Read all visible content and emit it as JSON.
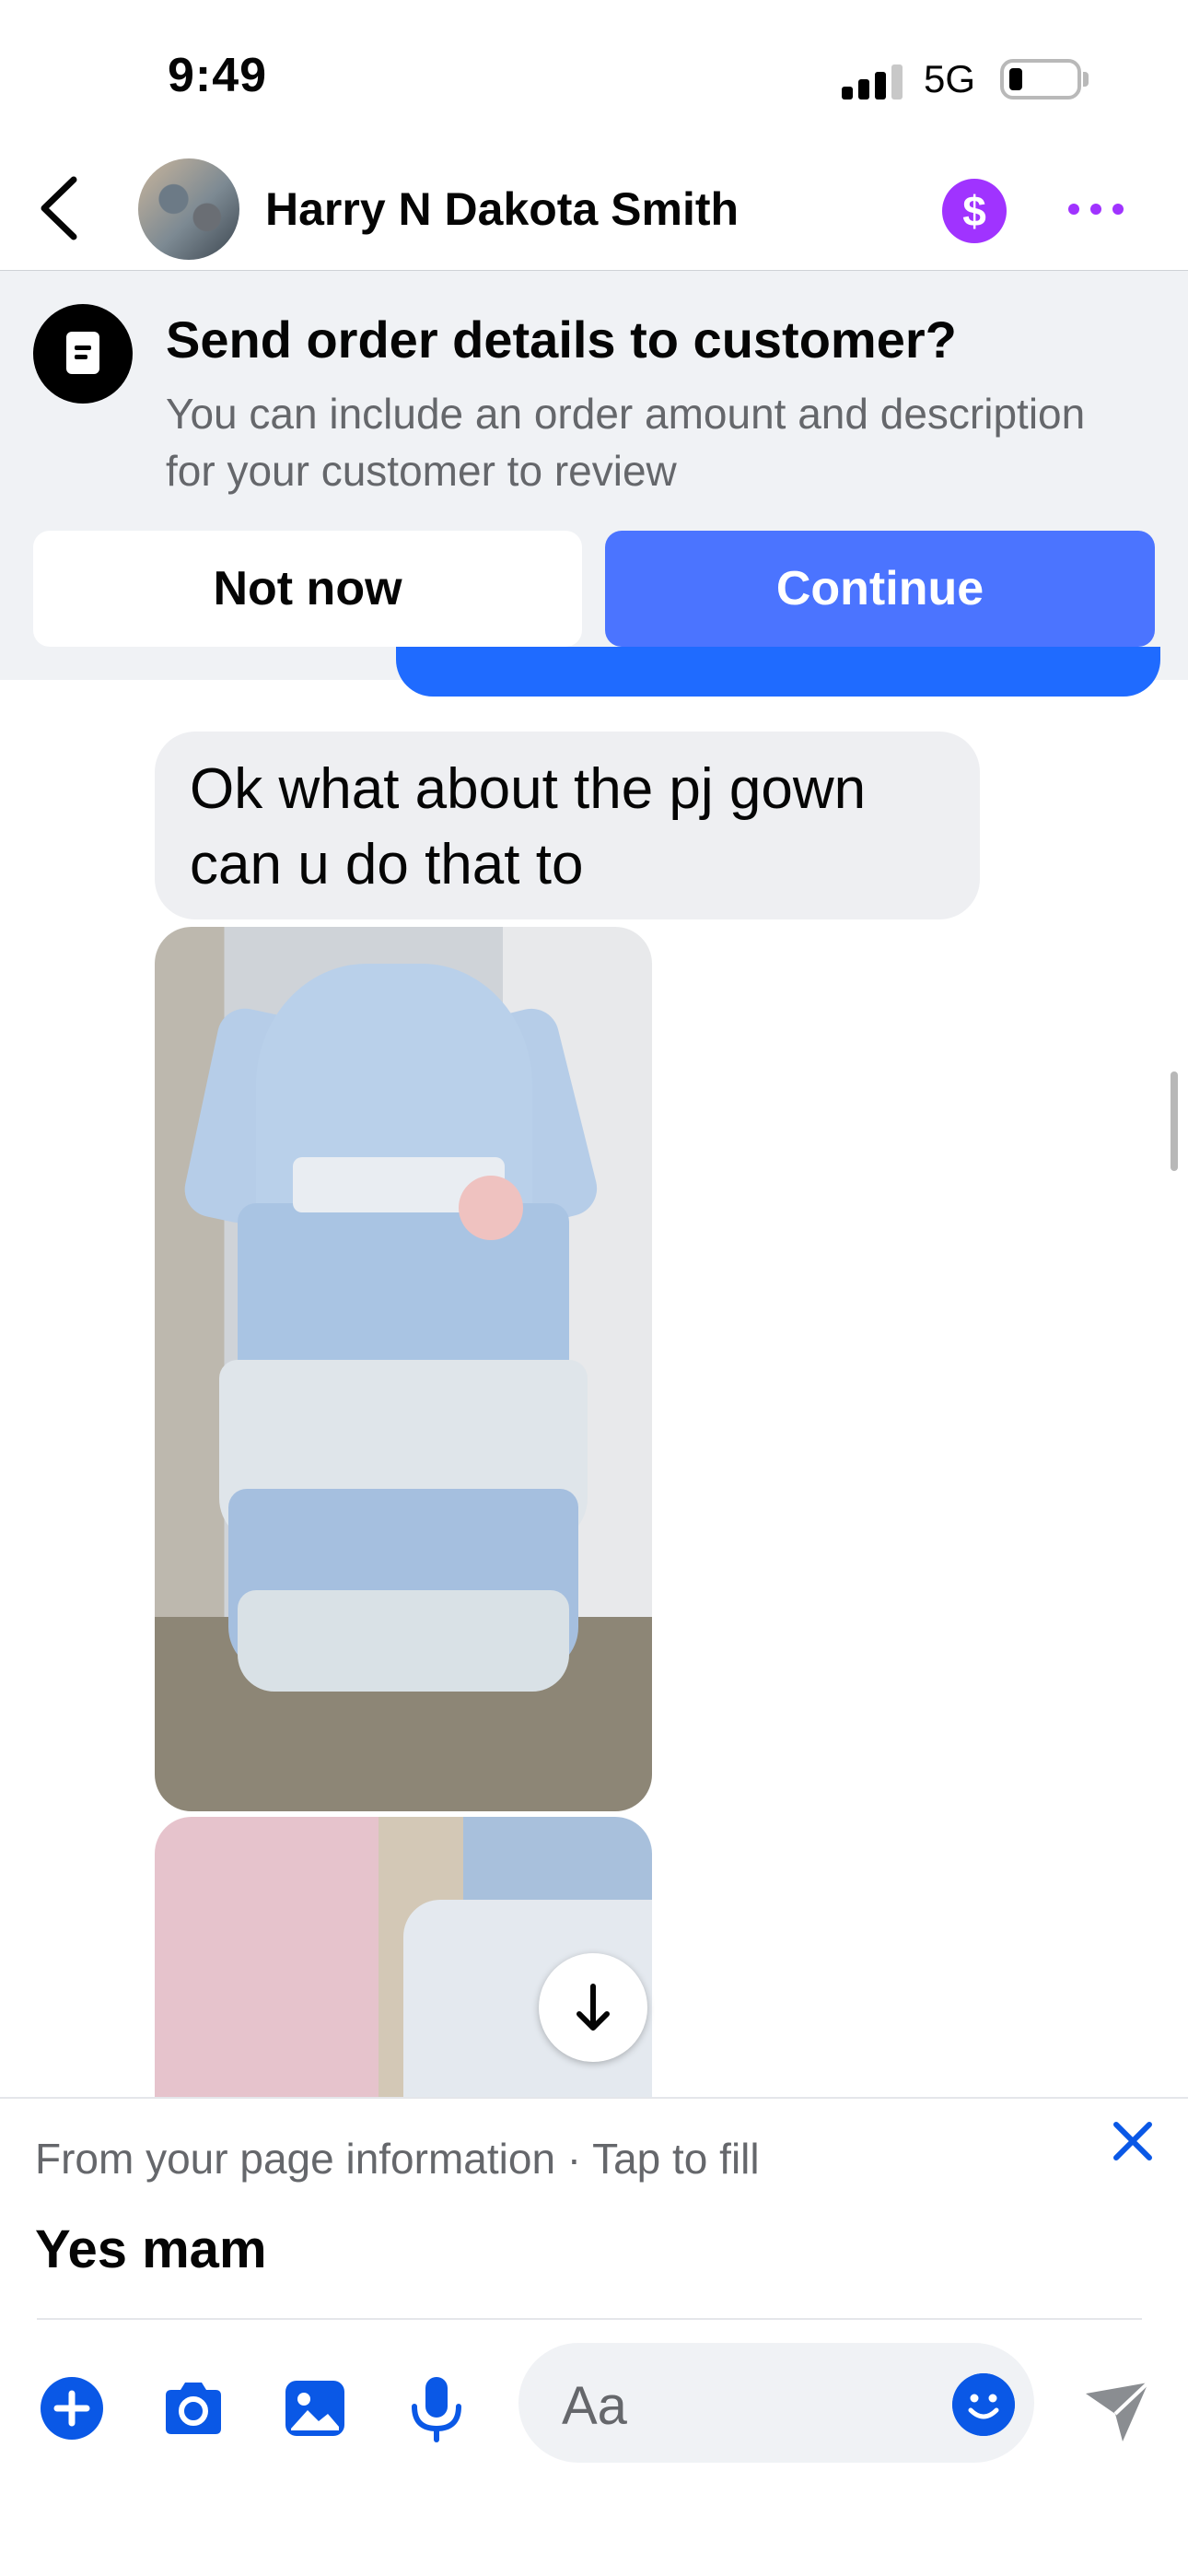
{
  "status_bar": {
    "time": "9:49",
    "network": "5G",
    "battery_level": 0.1
  },
  "header": {
    "contact_name": "Harry N Dakota Smith",
    "icons": [
      "back-icon",
      "avatar",
      "dollar-icon",
      "more-icon"
    ],
    "accent_color": "#a033ff"
  },
  "order_prompt": {
    "title": "Send order details to customer?",
    "description": "You can include an order amount and description for your customer to review",
    "not_now_label": "Not now",
    "continue_label": "Continue",
    "continue_color": "#4b74ff"
  },
  "chat": {
    "messages": [
      {
        "text": "Ok what about the pj gown can u do that to"
      }
    ]
  },
  "suggestion": {
    "note": "From your page information · Tap to fill",
    "text": "Yes mam"
  },
  "composer": {
    "placeholder": "Aa",
    "icons": [
      "plus-icon",
      "camera-icon",
      "photo-icon",
      "mic-icon",
      "emoji-icon",
      "send-icon"
    ],
    "icon_color": "#0a58e6"
  }
}
